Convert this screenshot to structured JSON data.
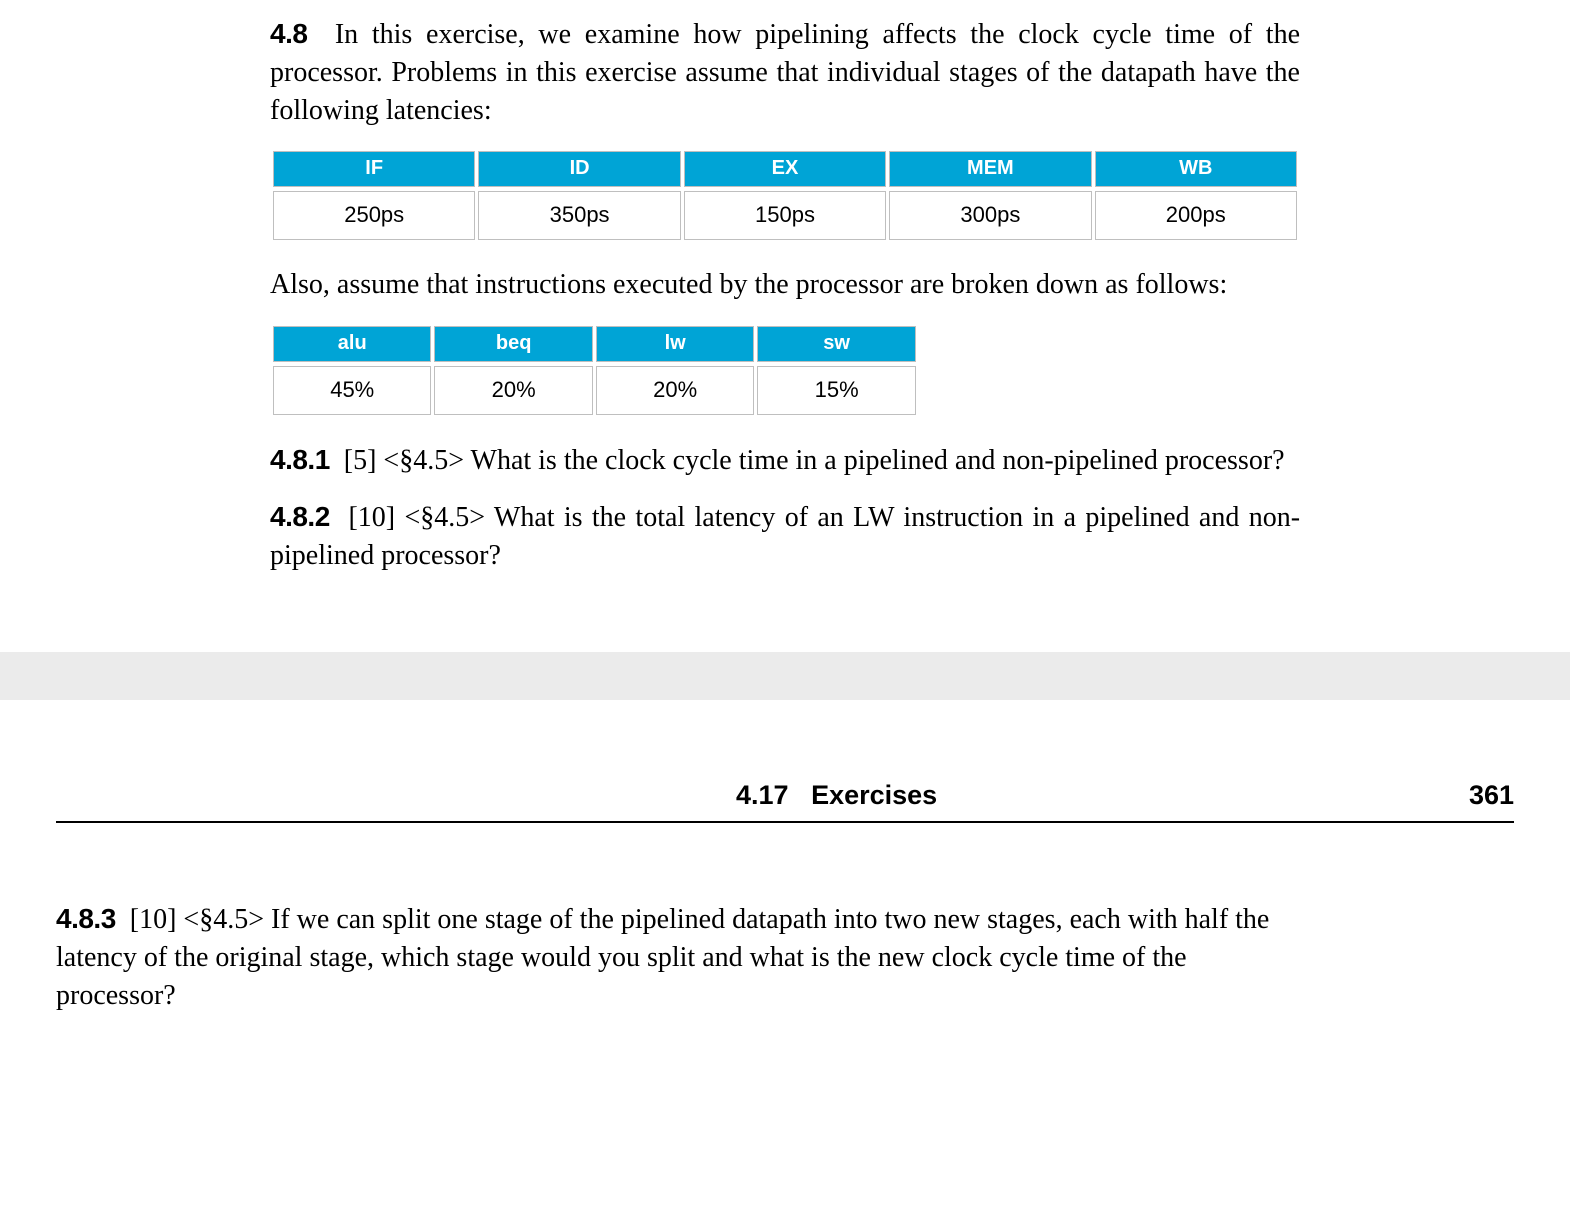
{
  "ex48": {
    "label": "4.8",
    "intro": "In this exercise, we examine how pipelining affects the clock cycle time of the processor. Problems in this exercise assume that individual stages of the datapath have the following latencies:"
  },
  "table1": {
    "headers": [
      "IF",
      "ID",
      "EX",
      "MEM",
      "WB"
    ],
    "values": [
      "250ps",
      "350ps",
      "150ps",
      "300ps",
      "200ps"
    ]
  },
  "also_text": "Also, assume that instructions executed by the processor are broken down as follows:",
  "table2": {
    "headers": [
      "alu",
      "beq",
      "lw",
      "sw"
    ],
    "values": [
      "45%",
      "20%",
      "20%",
      "15%"
    ]
  },
  "q481": {
    "label": "4.8.1",
    "meta": "[5] <§4.5>",
    "text": "What is the clock cycle time in a pipelined and non-pipelined processor?"
  },
  "q482": {
    "label": "4.8.2",
    "meta": "[10] <§4.5>",
    "text": "What is the total latency of an LW instruction in a pipelined and non-pipelined processor?"
  },
  "q483": {
    "label": "4.8.3",
    "meta": "[10] <§4.5>",
    "text": "If we can split one stage of the pipelined datapath into two new stages, each with half the latency of the original stage, which stage would you split and what is the new clock cycle time of the processor?"
  },
  "footer": {
    "section": "4.17",
    "title": "Exercises",
    "page": "361"
  },
  "chart_data": [
    {
      "type": "table",
      "title": "Pipeline stage latencies",
      "columns": [
        "IF",
        "ID",
        "EX",
        "MEM",
        "WB"
      ],
      "rows": [
        [
          "250ps",
          "350ps",
          "150ps",
          "300ps",
          "200ps"
        ]
      ]
    },
    {
      "type": "table",
      "title": "Instruction mix",
      "columns": [
        "alu",
        "beq",
        "lw",
        "sw"
      ],
      "rows": [
        [
          "45%",
          "20%",
          "20%",
          "15%"
        ]
      ]
    }
  ]
}
